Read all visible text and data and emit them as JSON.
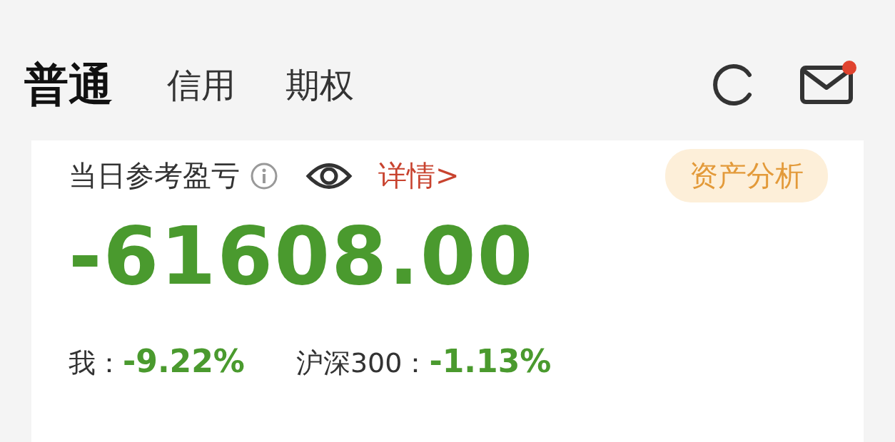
{
  "tabs": [
    {
      "label": "普通",
      "selected": true
    },
    {
      "label": "信用",
      "selected": false
    },
    {
      "label": "期权",
      "selected": false
    }
  ],
  "mail": {
    "unread": true
  },
  "pnl": {
    "label": "当日参考盈亏",
    "details_link": "详情>",
    "analysis_button": "资产分析",
    "value": "-61608.00"
  },
  "returns": [
    {
      "label": "我：",
      "value": "-9.22%"
    },
    {
      "label": "沪深300：",
      "value": "-1.13%"
    }
  ]
}
